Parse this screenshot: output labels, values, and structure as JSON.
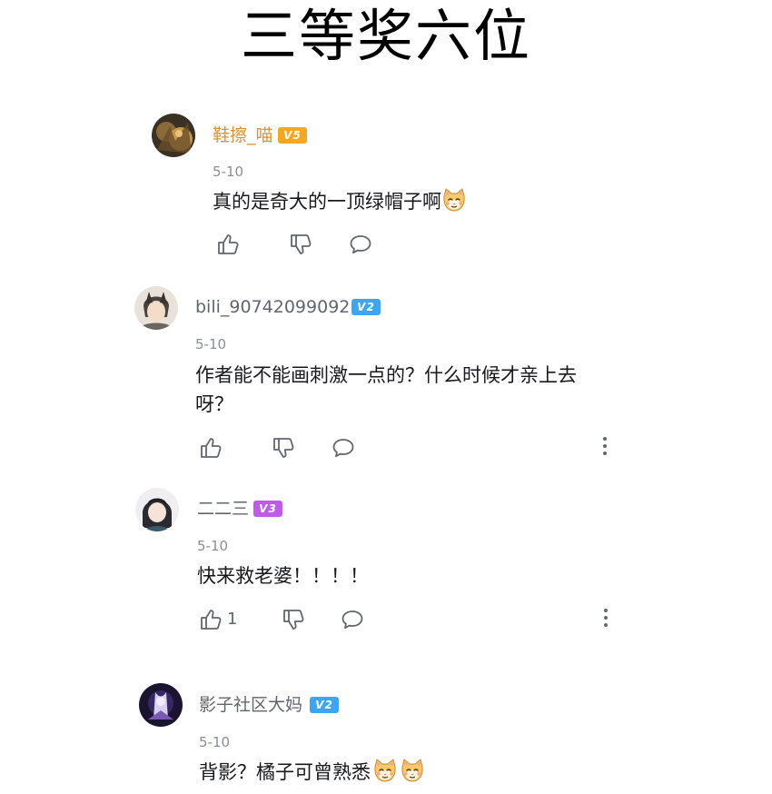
{
  "header": {
    "title": "三等奖六位"
  },
  "colors": {
    "v5_badge": "#f5a623",
    "v2_badge": "#3ea6f0",
    "v3_badge": "#c05ae8",
    "gold_name": "#e0912f"
  },
  "comments": [
    {
      "username": "鞋擦_喵",
      "level": "V5",
      "date": "5-10",
      "text": "真的是奇大的一顶绿帽子啊",
      "emoji": "cat-emoji"
    },
    {
      "username": "bili_90742099092",
      "level": "V2",
      "date": "5-10",
      "text_line1": "作者能不能画刺激一点的？什么时候才亲上去",
      "text_line2": "呀？"
    },
    {
      "username": "二二三",
      "level": "V3",
      "date": "5-10",
      "text": "快来救老婆！！！！",
      "like_count": "1"
    },
    {
      "username": "影子社区大妈",
      "level": "V2",
      "date": "5-10",
      "text": "背影？橘子可曾熟悉",
      "emoji": "cat-emoji"
    }
  ]
}
